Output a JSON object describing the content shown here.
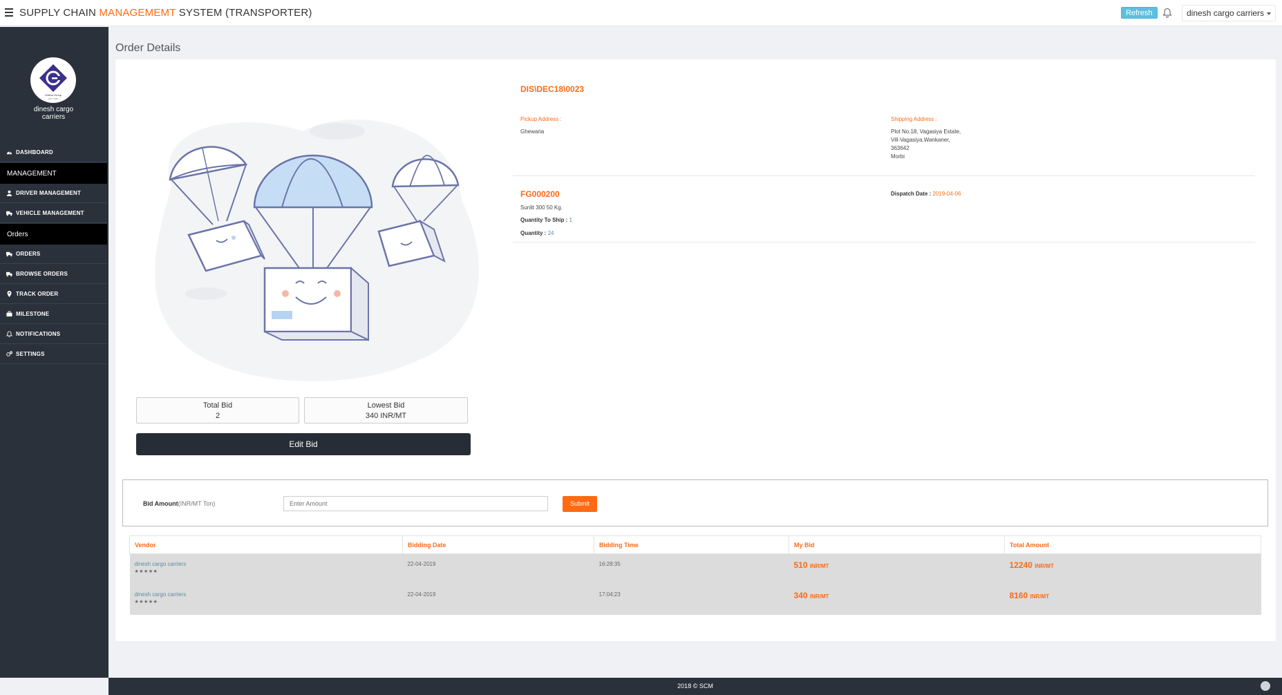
{
  "header": {
    "title_prefix": "SUPPLY CHAIN ",
    "title_accent": "MANAGEMEMT",
    "title_suffix": " SYSTEM (TRANSPORTER)",
    "refresh_label": "Refresh",
    "user_name": "dinesh cargo carriers",
    "icons": [
      "hamburger-icon",
      "bell-icon",
      "caret-down-icon"
    ]
  },
  "sidebar": {
    "brand_line1": "dinesh cargo",
    "brand_line2": "carriers",
    "logo_text": "Gokha Group",
    "logo_since": "EST. 1990",
    "items": [
      {
        "label": "DASHBOARD",
        "icon": "dashboard-icon"
      },
      {
        "label": "MANAGEMENT",
        "type": "section"
      },
      {
        "label": "DRIVER MANAGEMENT",
        "icon": "user-icon"
      },
      {
        "label": "VEHICLE MANAGEMENT",
        "icon": "truck-icon"
      },
      {
        "label": "Orders",
        "type": "section"
      },
      {
        "label": "ORDERS",
        "icon": "truck-icon"
      },
      {
        "label": "BROWSE ORDERS",
        "icon": "truck-icon"
      },
      {
        "label": "TRACK ORDER",
        "icon": "map-marker-icon"
      },
      {
        "label": "MILESTONE",
        "icon": "briefcase-icon"
      },
      {
        "label": "NOTIFICATIONS",
        "icon": "bell-icon"
      },
      {
        "label": "SETTINGS",
        "icon": "gears-icon"
      }
    ]
  },
  "page": {
    "title": "Order Details"
  },
  "order": {
    "number": "DIS\\DEC18\\0023",
    "pickup_label": "Pickup Address :",
    "pickup_value": "Ghewaria",
    "shipping_label": "Shipping Address :",
    "shipping_lines": [
      "Plot No.18, Vagasiya Estate,",
      "Vill-Vagasiya,Wankaner,",
      "363642",
      "Morbi"
    ],
    "product_code": "FG000200",
    "product_name": "Sunlit 300 50 Kg.",
    "qty_to_ship_label": "Quantity To Ship :",
    "qty_to_ship_value": "1",
    "quantity_label": "Quantity :",
    "quantity_value": "24",
    "dispatch_label": "Dispatch Date :",
    "dispatch_value": "2019-04-06"
  },
  "bid_summary": {
    "total_label": "Total Bid",
    "total_value": "2",
    "lowest_label": "Lowest Bid",
    "lowest_value": "340 INR/MT",
    "edit_label": "Edit Bid"
  },
  "bid_form": {
    "label": "Bid Amount",
    "unit": "(INR/MT Ton)",
    "placeholder": "Enter Amount",
    "submit_label": "Submit"
  },
  "bid_table": {
    "columns": [
      "Vendor",
      "Bidding Date",
      "Bidding Time",
      "My Bid",
      "Total Amount"
    ],
    "rows": [
      {
        "vendor": "dinesh cargo carriers",
        "stars": "★★★★★",
        "date": "22-04-2019",
        "time": "16:28:35",
        "bid": "510",
        "bid_unit": "INR/MT",
        "total": "12240",
        "total_unit": "INR/MT"
      },
      {
        "vendor": "dinesh cargo carriers",
        "stars": "★★★★★",
        "date": "22-04-2019",
        "time": "17:04:23",
        "bid": "340",
        "bid_unit": "INR/MT",
        "total": "8160",
        "total_unit": "INR/MT"
      }
    ]
  },
  "footer": {
    "text": "2018 © SCM"
  }
}
